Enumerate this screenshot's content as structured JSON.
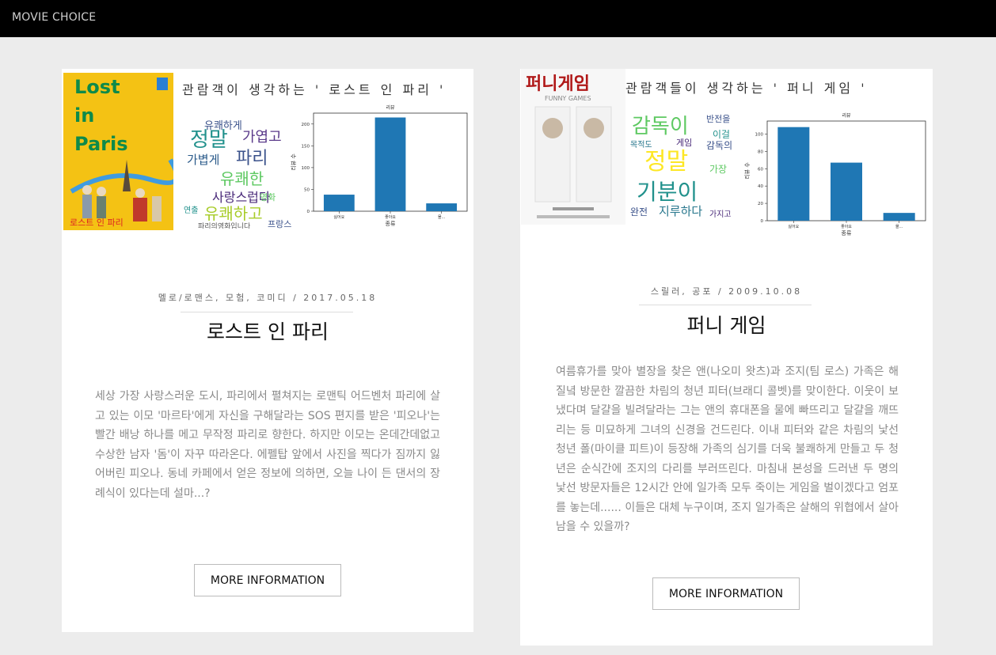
{
  "navbar": {
    "brand": "MOVIE CHOICE"
  },
  "movies": [
    {
      "review_heading": "관람객이 생각하는 ' 로스트 인 파리 '",
      "poster_text": {
        "line1": "Lost",
        "line2": "in",
        "line3": "Paris",
        "kr": "로스트 인 파리"
      },
      "wordcloud_words": [
        "유쾌하게",
        "가엽고",
        "정말",
        "가볍게",
        "파리",
        "유쾌한",
        "사랑스럽다",
        "유쾌하고",
        "파리의영화입니다",
        "프랑스",
        "연출",
        "영화"
      ],
      "chart_data": {
        "type": "bar",
        "title": "리뷰",
        "xlabel": "종류",
        "ylabel": "리뷰 수",
        "categories": [
          "싫어요",
          "좋아요",
          "몰..."
        ],
        "values": [
          38,
          215,
          18
        ],
        "ylim": [
          0,
          225
        ],
        "yticks": [
          0,
          50,
          100,
          150,
          200
        ],
        "bar_color": "#1f77b4"
      },
      "meta": "멜로/로맨스, 모험, 코미디 / 2017.05.18",
      "title": "로스트 인 파리",
      "description": "세상 가장 사랑스러운 도시, 파리에서 펼쳐지는 로맨틱 어드벤처 파리에 살고 있는 이모 '마르타'에게 자신을 구해달라는 SOS 편지를 받은 '피오나'는 빨간 배낭 하나를 메고 무작정 파리로 향한다. 하지만 이모는 온데간데없고 수상한 남자 '돔'이 자꾸 따라온다. 에펠탑 앞에서 사진을 찍다가 짐까지 잃어버린 피오나. 동네 카페에서 얻은 정보에 의하면, 오늘 나이 든 댄서의 장례식이 있다는데 설마...?",
      "button_label": "MORE INFORMATION"
    },
    {
      "review_heading": "관람객들이 생각하는 ' 퍼니 게임 '",
      "poster_text": {
        "kr": "퍼니게임",
        "en": "FUNNY GAMES"
      },
      "wordcloud_words": [
        "감독이",
        "정말",
        "기분이",
        "반전을",
        "이걸",
        "게임",
        "감독의",
        "지루하다",
        "가장",
        "완전",
        "가지고",
        "목적도"
      ],
      "chart_data": {
        "type": "bar",
        "title": "리뷰",
        "xlabel": "종류",
        "ylabel": "리뷰 수",
        "categories": [
          "싫어요",
          "좋아요",
          "몰..."
        ],
        "values": [
          108,
          67,
          9
        ],
        "ylim": [
          0,
          115
        ],
        "yticks": [
          0,
          20,
          40,
          60,
          80,
          100
        ],
        "bar_color": "#1f77b4"
      },
      "meta": "스릴러, 공포 / 2009.10.08",
      "title": "퍼니 게임",
      "description": "여름휴가를 맞아 별장을 찾은 앤(나오미 왓츠)과 조지(팀 로스) 가족은 해질녘 방문한 깔끔한 차림의 청년 피터(브래디 콜벳)를 맞이한다. 이웃이 보냈다며 달걀을 빌려달라는 그는 앤의 휴대폰을 물에 빠뜨리고 달걀을 깨뜨리는 등 미묘하게 그녀의 신경을 건드린다. 이내 피터와 같은 차림의 낯선 청년 폴(마이클 피트)이 등장해 가족의 심기를 더욱 불쾌하게 만들고 두 청년은 순식간에 조지의 다리를 부러뜨린다. 마침내 본성을 드러낸 두 명의 낯선 방문자들은 12시간 안에 일가족 모두 죽이는 게임을 벌이겠다고 엄포를 놓는데...... 이들은 대체 누구이며, 조지 일가족은 살해의 위협에서 살아남을 수 있을까?",
      "button_label": "MORE INFORMATION"
    }
  ]
}
